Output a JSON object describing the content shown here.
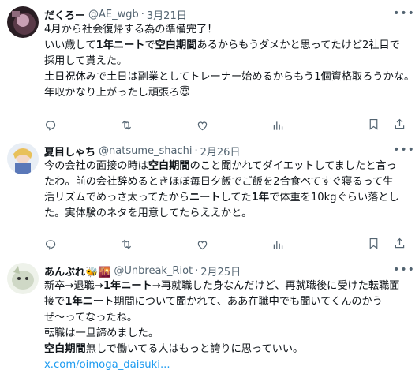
{
  "tweets": [
    {
      "name": "だくろー",
      "handle": "@AE_wgb",
      "date": "3月21日",
      "lines": [
        [
          "4月から社会復帰する為の準備完了！"
        ],
        [
          "いい歳して",
          {
            "b": "1年ニート"
          },
          "で",
          {
            "b": "空白期間"
          },
          "あるからもうダメかと思ってたけど2社目で"
        ],
        [
          "採用して貰えた。"
        ],
        [
          "土日祝休みで土日は副業としてトレーナー始めるからもう1個資格取ろうかな。"
        ],
        [
          "年収かなり上がったし頑張ろ😇"
        ]
      ]
    },
    {
      "name": "夏目しゃち",
      "handle": "@natsume_shachi",
      "date": "2月26日",
      "lines": [
        [
          "今の会社の面接の時は",
          {
            "b": "空白期間"
          },
          "のこと聞かれてダイエットしてましたと言っ"
        ],
        [
          "たわ。前の会社辞めるときほぼ毎日夕飯でご飯を2合食べてすぐ寝るって生"
        ],
        [
          "活リズムでめっさ太ってたから",
          {
            "b": "ニート"
          },
          "してた",
          {
            "b": "1年"
          },
          "で体重を10kgぐらい落とし"
        ],
        [
          "た。実体験のネタを用意してたらええかと。"
        ]
      ]
    },
    {
      "name": "あんぶれ🐝🌇",
      "handle": "@Unbreak_Riot",
      "date": "2月25日",
      "lines": [
        [
          "新卒→退職→",
          {
            "b": "1年ニート"
          },
          "→再就職した身なんだけど、再就職後に受けた転職面"
        ],
        [
          "接で",
          {
            "b": "1年ニート"
          },
          "期間について聞かれて、ああ在職中でも聞いてくんのかう"
        ],
        [
          "ぜ～ってなったね。"
        ],
        [
          "転職は一旦諦めました。"
        ],
        [
          {
            "b": "空白期間"
          },
          "無しで働いてる人はもっと誇りに思っていい。"
        ]
      ],
      "link": "x.com/oimoga_daisuki..."
    }
  ],
  "icons": [
    "reply-icon",
    "retweet-icon",
    "like-icon",
    "views-icon",
    "bookmark-icon",
    "share-icon",
    "more-icon"
  ]
}
